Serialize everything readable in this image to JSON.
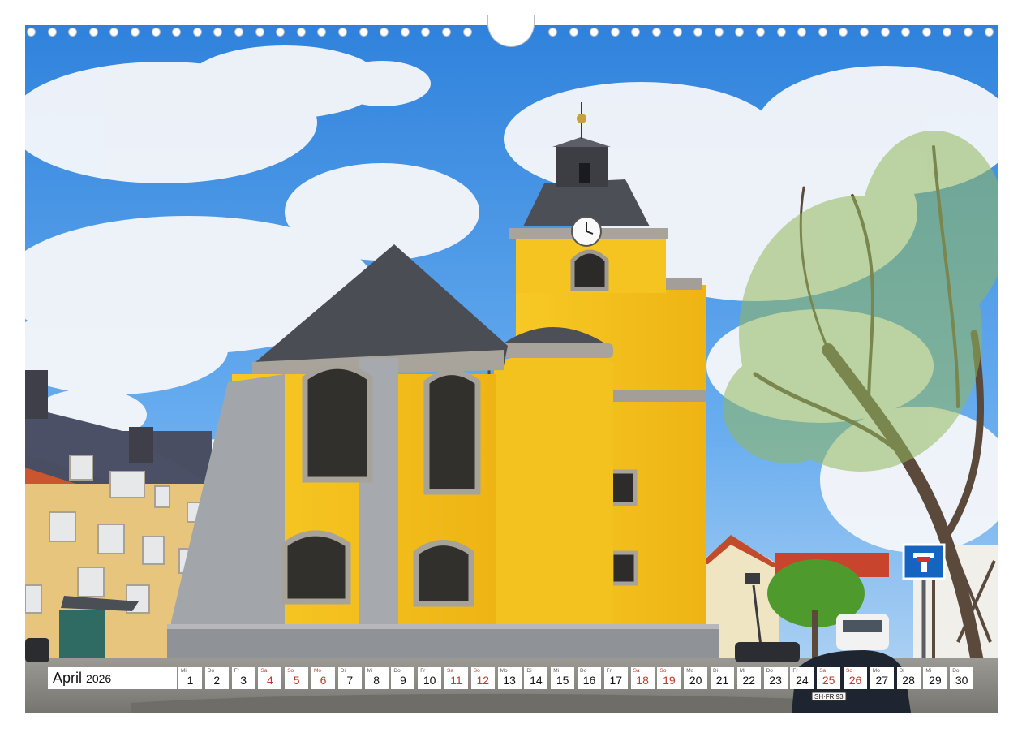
{
  "calendar": {
    "month": "April",
    "year": "2026",
    "days": [
      {
        "wd": "Mi",
        "num": "1"
      },
      {
        "wd": "Do",
        "num": "2"
      },
      {
        "wd": "Fr",
        "num": "3"
      },
      {
        "wd": "Sa",
        "num": "4",
        "we": true
      },
      {
        "wd": "So",
        "num": "5",
        "we": true
      },
      {
        "wd": "Mo",
        "num": "6",
        "we": true
      },
      {
        "wd": "Di",
        "num": "7"
      },
      {
        "wd": "Mi",
        "num": "8"
      },
      {
        "wd": "Do",
        "num": "9"
      },
      {
        "wd": "Fr",
        "num": "10"
      },
      {
        "wd": "Sa",
        "num": "11",
        "we": true
      },
      {
        "wd": "So",
        "num": "12",
        "we": true
      },
      {
        "wd": "Mo",
        "num": "13"
      },
      {
        "wd": "Di",
        "num": "14"
      },
      {
        "wd": "Mi",
        "num": "15"
      },
      {
        "wd": "Do",
        "num": "16"
      },
      {
        "wd": "Fr",
        "num": "17"
      },
      {
        "wd": "Sa",
        "num": "18",
        "we": true
      },
      {
        "wd": "So",
        "num": "19",
        "we": true
      },
      {
        "wd": "Mo",
        "num": "20"
      },
      {
        "wd": "Di",
        "num": "21"
      },
      {
        "wd": "Mi",
        "num": "22"
      },
      {
        "wd": "Do",
        "num": "23"
      },
      {
        "wd": "Fr",
        "num": "24"
      },
      {
        "wd": "Sa",
        "num": "25",
        "we": true
      },
      {
        "wd": "So",
        "num": "26",
        "we": true
      },
      {
        "wd": "Mo",
        "num": "27"
      },
      {
        "wd": "Di",
        "num": "28"
      },
      {
        "wd": "Mi",
        "num": "29"
      },
      {
        "wd": "Do",
        "num": "30"
      }
    ]
  },
  "photo": {
    "subject": "yellow-baroque-church-icon",
    "colors": {
      "sky": "#3b8fe0",
      "facade": "#f5c21b",
      "stone": "#9a9ea3",
      "roof": "#4a4c52",
      "cobble": "#8e8c88"
    }
  },
  "car_plate": "SH·FR 93"
}
